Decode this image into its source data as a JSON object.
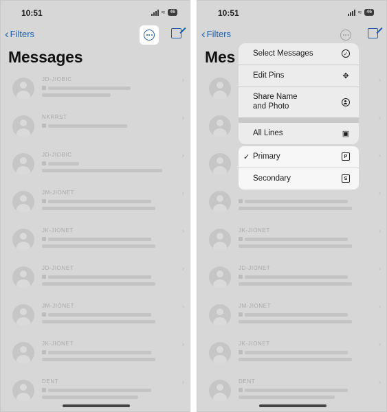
{
  "status": {
    "time": "10:51",
    "battery": "46"
  },
  "nav": {
    "back_label": "Filters"
  },
  "title": "Messages",
  "title_clipped": "Mes",
  "conversations": [
    {
      "sender": "JD-JIOBIC"
    },
    {
      "sender": "NKRRST"
    },
    {
      "sender": "JD-JIOBIC"
    },
    {
      "sender": "JM-JIONET"
    },
    {
      "sender": "JK-JIONET"
    },
    {
      "sender": "JD-JIONET"
    },
    {
      "sender": "JM-JIONET"
    },
    {
      "sender": "JK-JIONET"
    },
    {
      "sender": "DENT"
    }
  ],
  "menu": {
    "items": [
      {
        "label": "Select Messages",
        "icon": "checkmark-circle-icon"
      },
      {
        "label": "Edit Pins",
        "icon": "pin-icon"
      },
      {
        "label": "Share Name\nand Photo",
        "icon": "person-circle-icon"
      },
      {
        "label": "All Lines",
        "icon": "sim-lines-icon"
      }
    ],
    "lines": [
      {
        "label": "Primary",
        "badge": "P",
        "checked": true
      },
      {
        "label": "Secondary",
        "badge": "S",
        "checked": false
      }
    ]
  },
  "colors": {
    "accent": "#1f5ea8",
    "dim_overlay": "#d7d7d7"
  }
}
